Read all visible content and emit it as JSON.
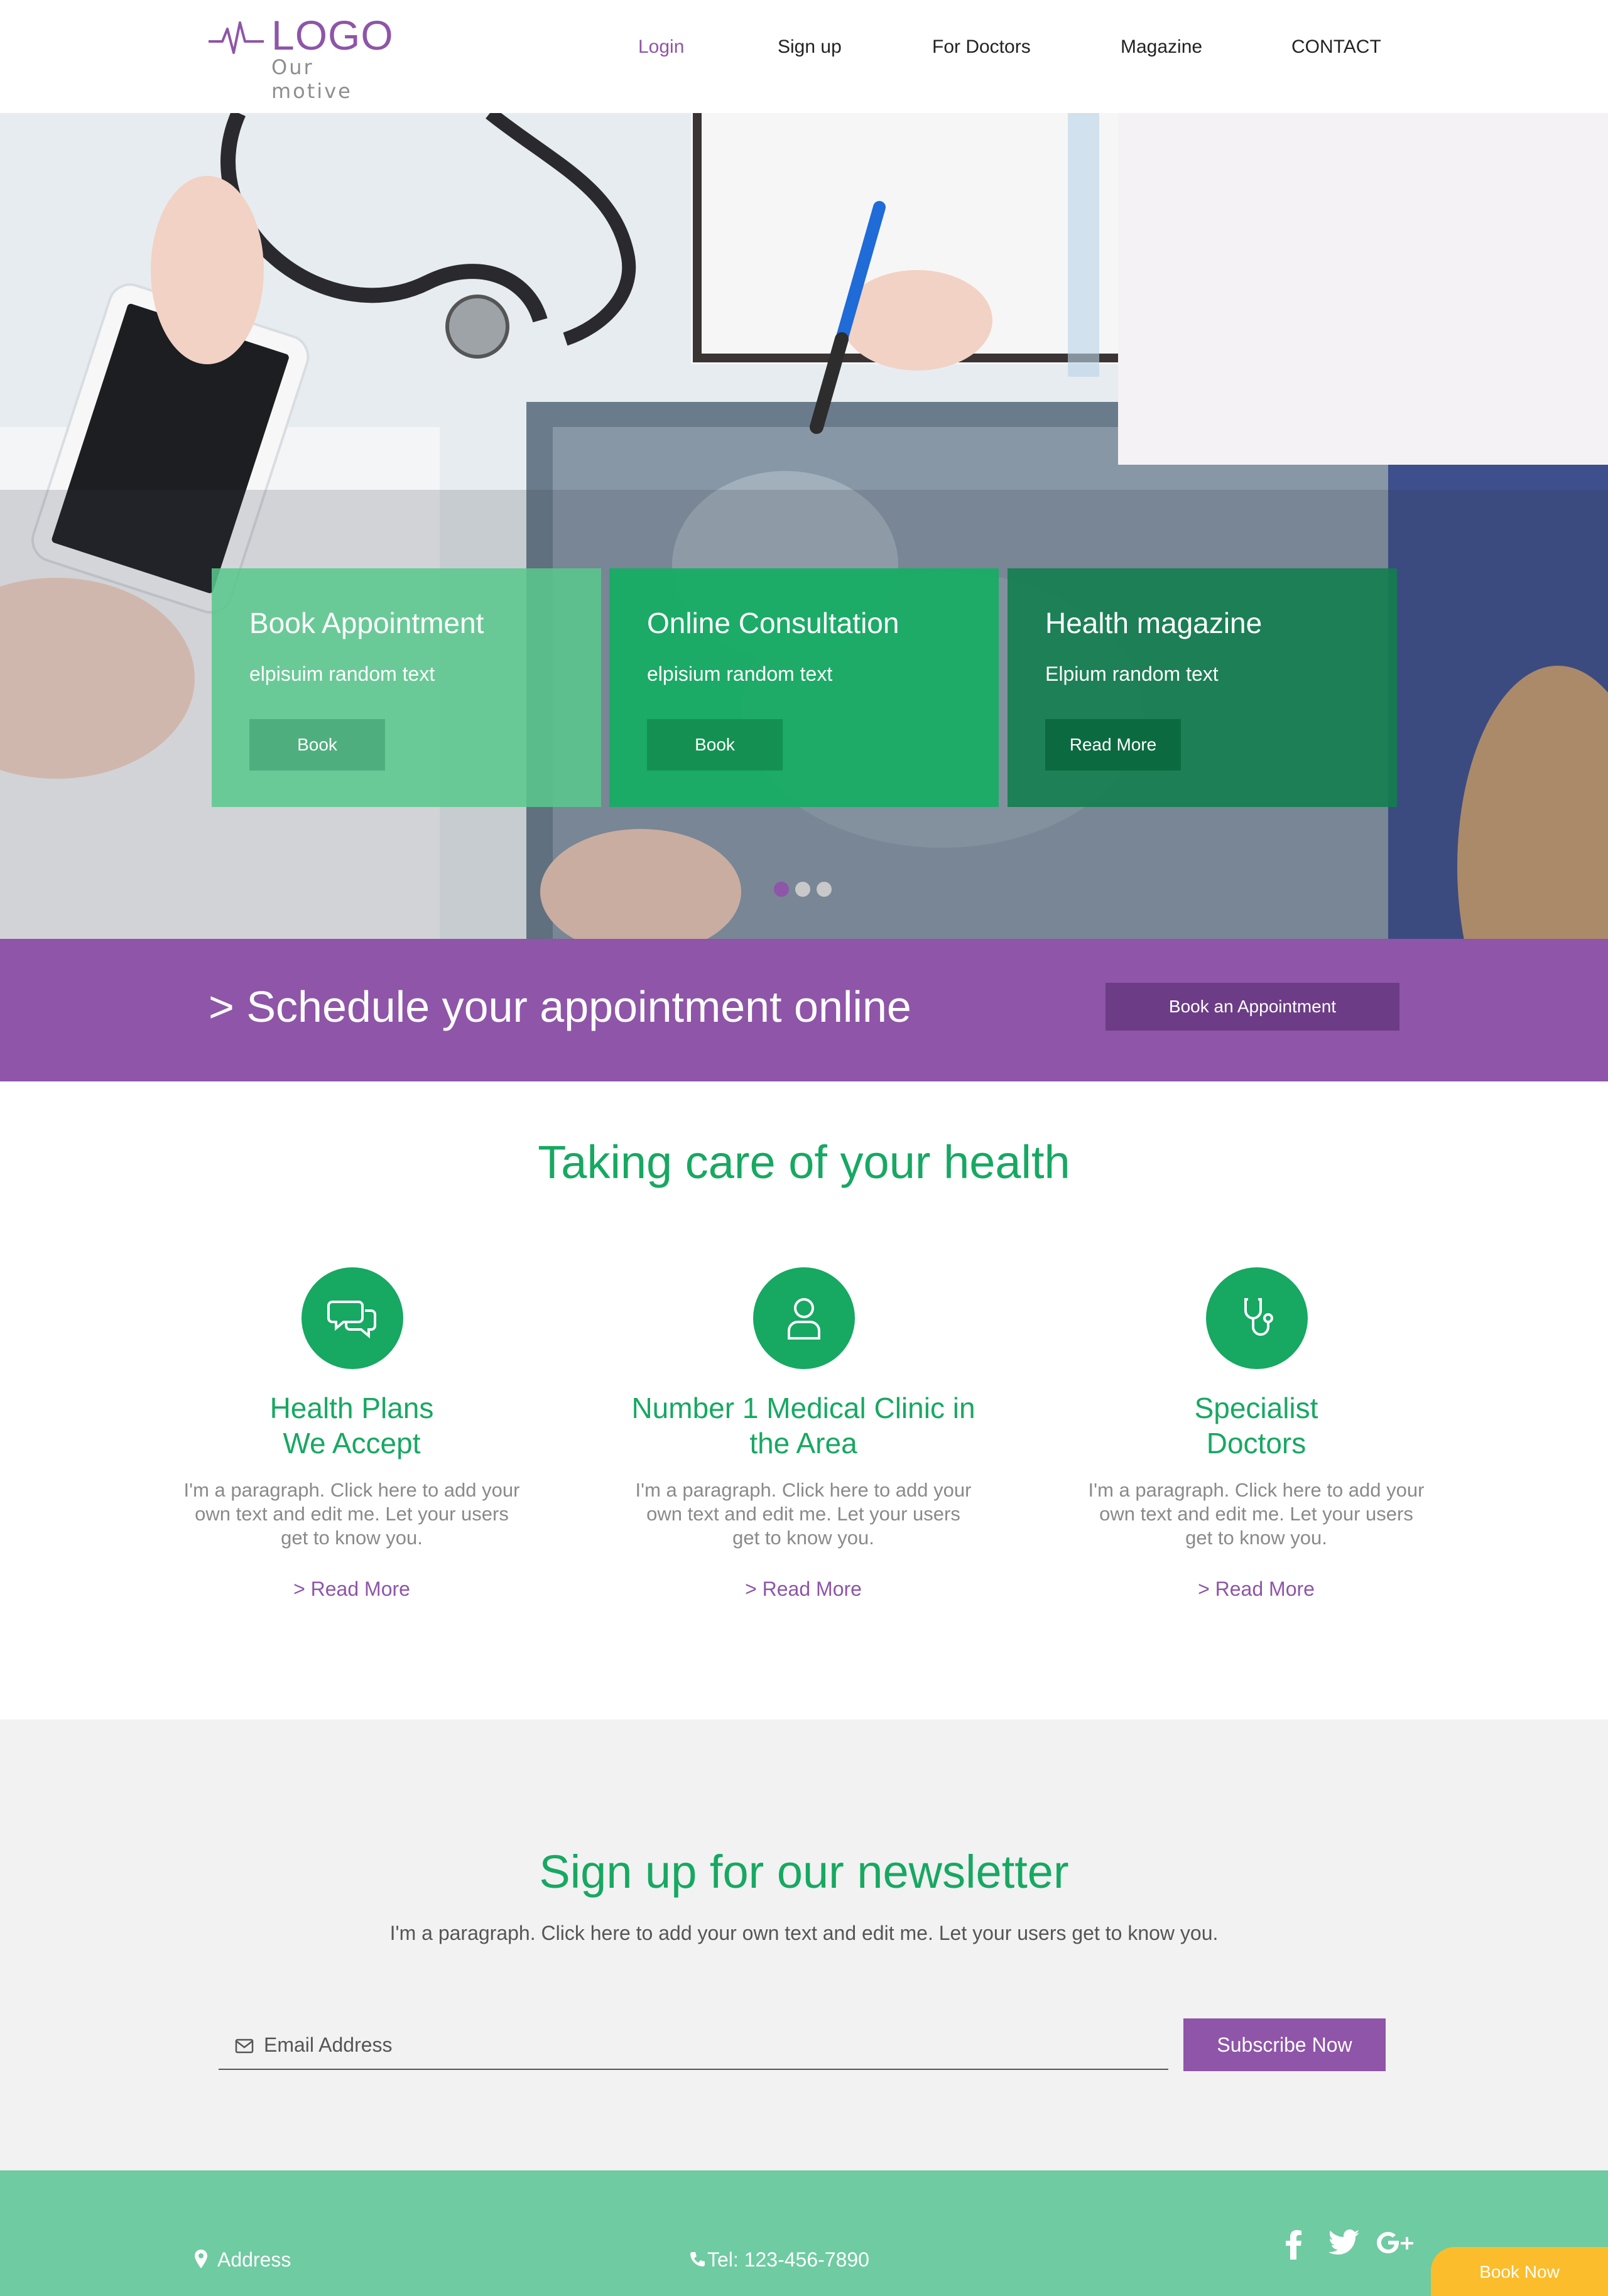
{
  "header": {
    "logo_text": "LOGO",
    "logo_sub": "Our motive",
    "nav": {
      "login": "Login",
      "signup": "Sign up",
      "doctors": "For Doctors",
      "magazine": "Magazine",
      "contact": "CONTACT"
    }
  },
  "hero": {
    "cards": [
      {
        "title": "Book Appointment",
        "text": "elpisuim random text",
        "button": "Book"
      },
      {
        "title": "Online Consultation",
        "text": "elpisium random text",
        "button": "Book"
      },
      {
        "title": "Health magazine",
        "text": "Elpium random text",
        "button": "Read More"
      }
    ],
    "slider": {
      "slides": 3,
      "active": 1
    }
  },
  "banner": {
    "text": "> Schedule your appointment online",
    "button": "Book an Appointment"
  },
  "features": {
    "title": "Taking care of your health",
    "items": [
      {
        "icon": "chat-bubbles-icon",
        "title_line1": "Health Plans",
        "title_line2": "We Accept",
        "paragraph": "I'm a paragraph. Click here to add your own text and edit me. Let your users get to know you.",
        "link": "> Read More"
      },
      {
        "icon": "user-icon",
        "title_line1": "Number 1 Medical Clinic in",
        "title_line2": "the Area",
        "paragraph": "I'm a paragraph. Click here to add your own text and edit me. Let your users get to know you.",
        "link": "> Read More"
      },
      {
        "icon": "stethoscope-icon",
        "title_line1": "Specialist",
        "title_line2": "Doctors",
        "paragraph": "I'm a paragraph. Click here to add your own text and edit me. Let your users get to know you.",
        "link": "> Read More"
      }
    ]
  },
  "newsletter": {
    "title": "Sign up for our newsletter",
    "paragraph": "I'm a paragraph. Click here to add your own text and edit me. Let your users get to know you.",
    "email_placeholder": "Email Address",
    "button": "Subscribe Now"
  },
  "footer": {
    "address": "Address",
    "tel": "Tel: 123-456-7890",
    "social": [
      "facebook-icon",
      "twitter-icon",
      "google-plus-icon"
    ],
    "book_now": "Book Now"
  },
  "colors": {
    "brand_purple": "#8e55a8",
    "brand_green": "#17a862",
    "footer_green": "#6fcba1",
    "book_now_yellow": "#fbbd2c"
  }
}
